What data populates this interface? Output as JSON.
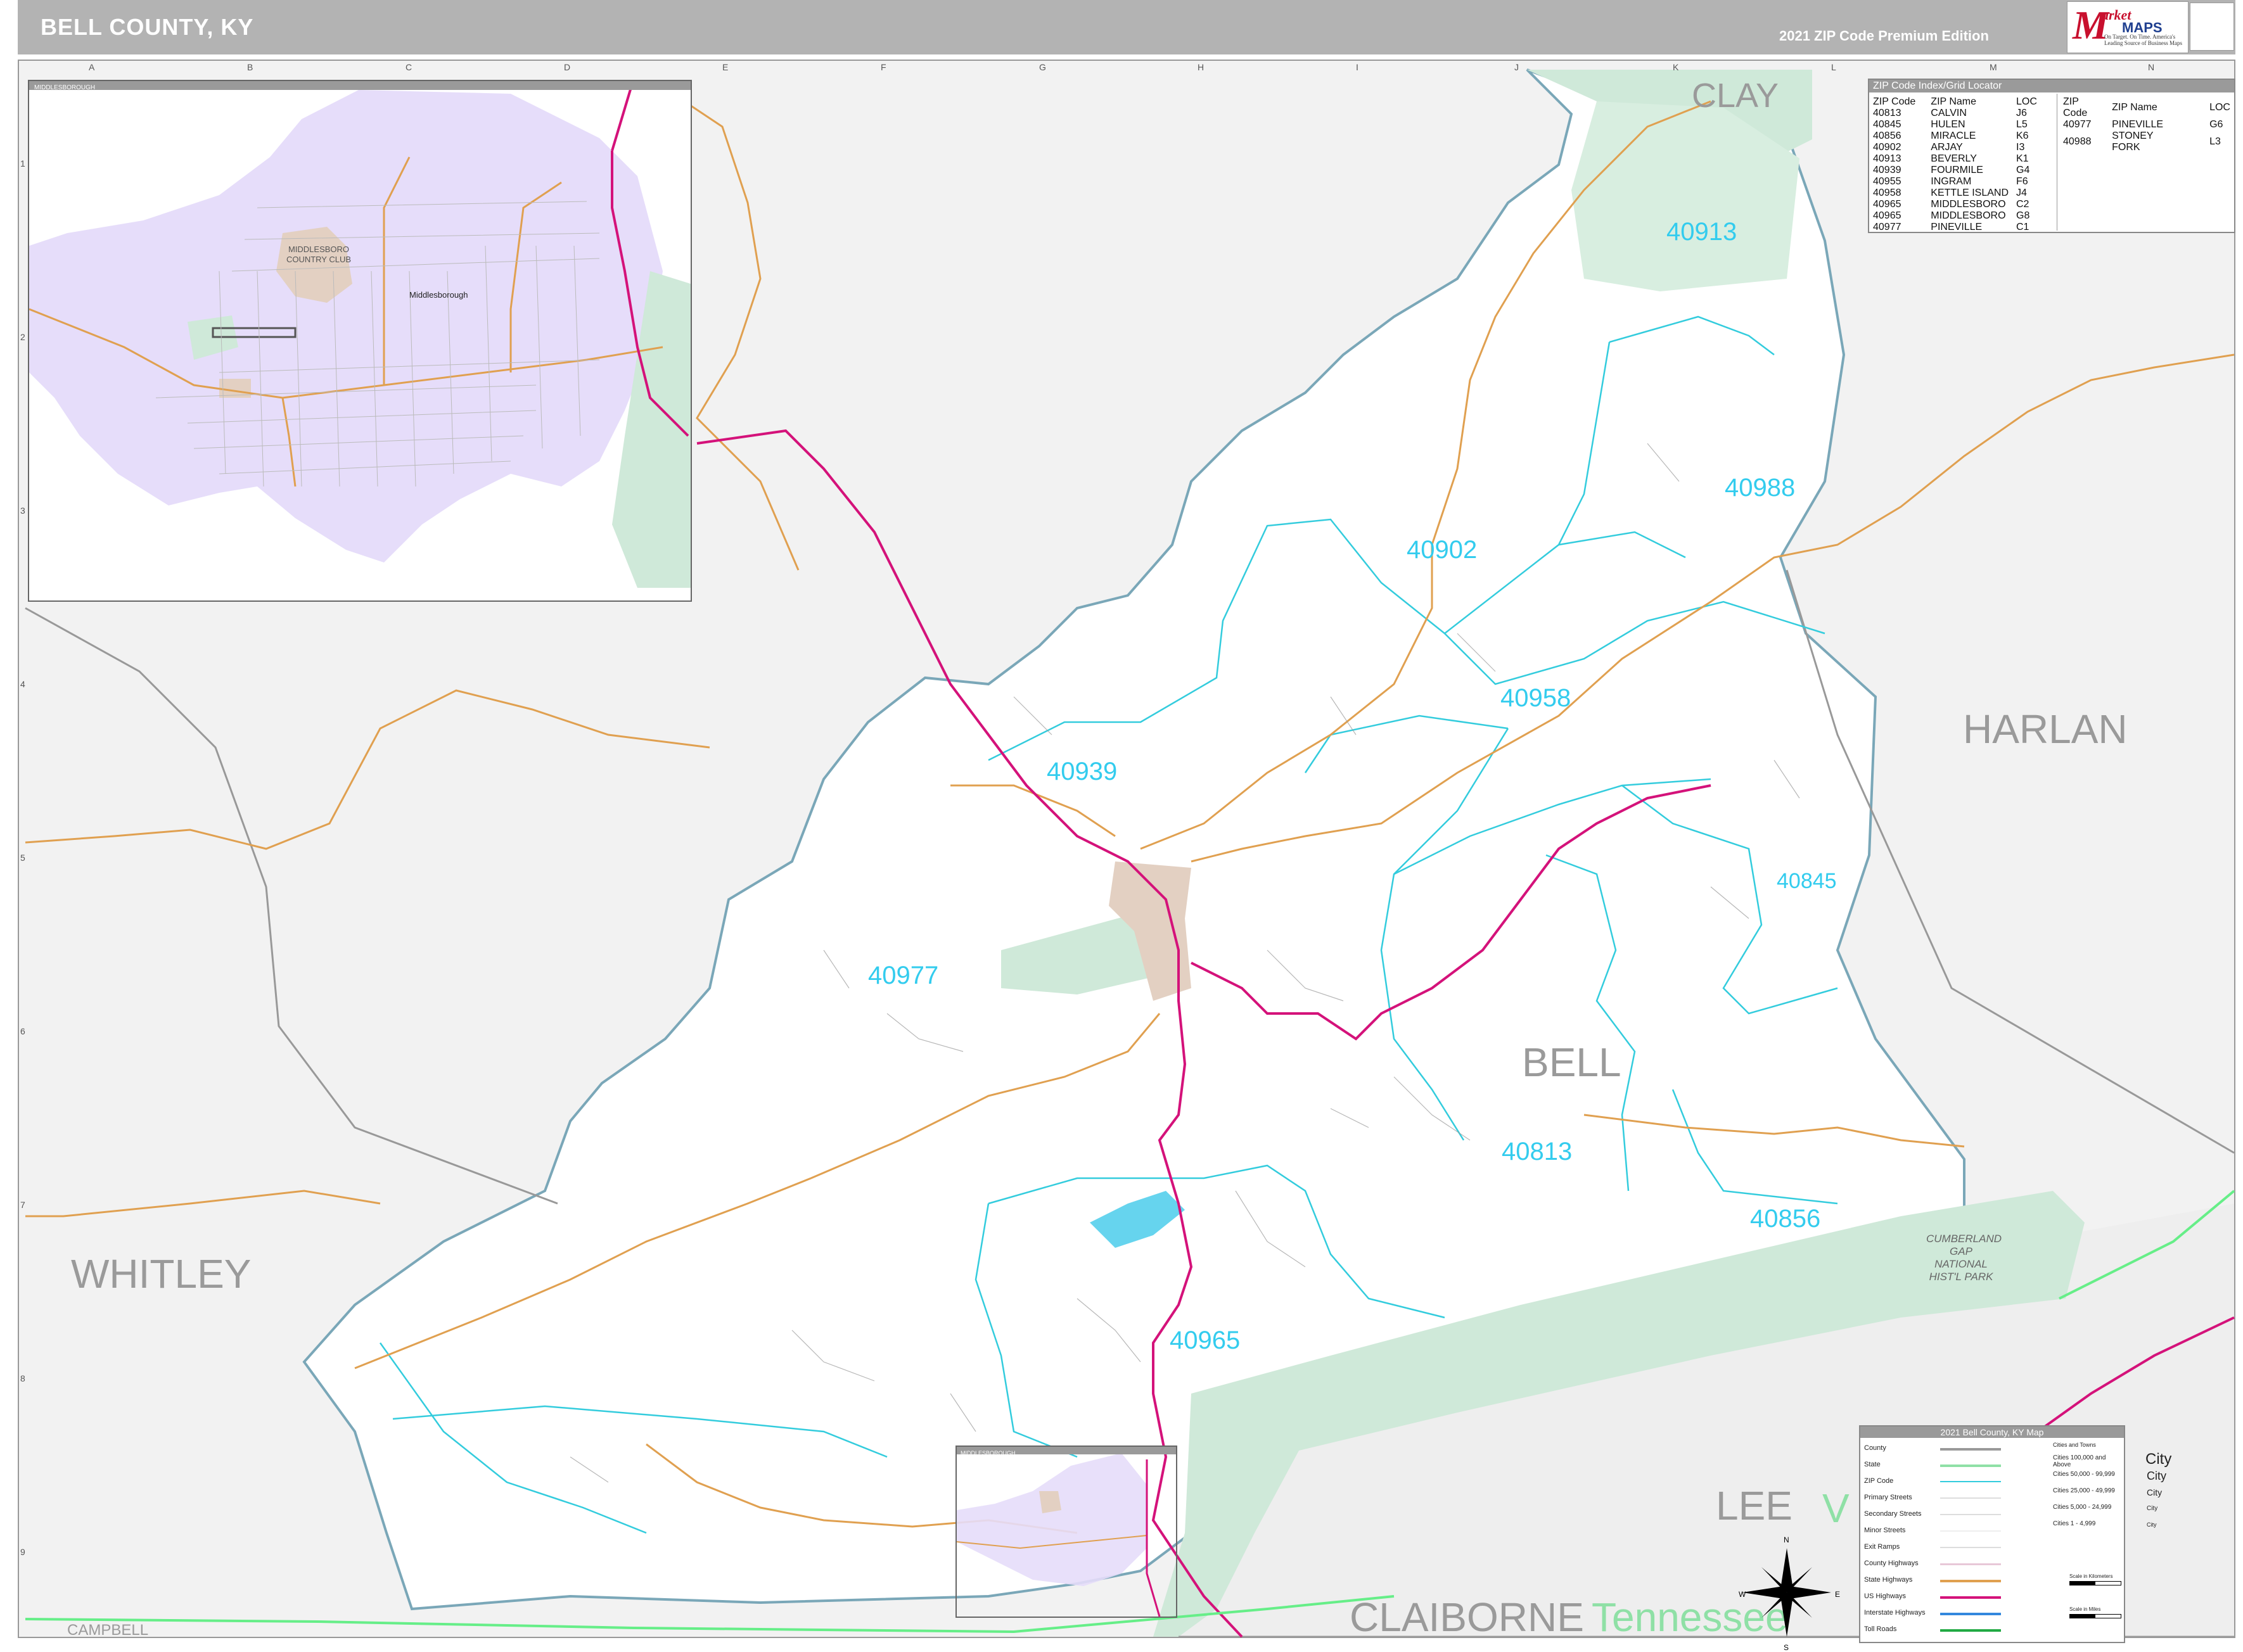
{
  "header": {
    "title": "BELL COUNTY, KY",
    "edition": "2021 ZIP Code Premium Edition",
    "logo_letter": "M",
    "logo_line1": "arket",
    "logo_line2": "MAPS",
    "logo_tagline": "On Target. On Time. America's Leading Source of Business Maps"
  },
  "grid": {
    "columns": [
      "A",
      "B",
      "C",
      "D",
      "E",
      "F",
      "G",
      "H",
      "I",
      "J",
      "K",
      "L",
      "M",
      "N"
    ],
    "rows": [
      "1",
      "2",
      "3",
      "4",
      "5",
      "6",
      "7",
      "8",
      "9"
    ]
  },
  "county_labels": {
    "clay": "CLAY",
    "harlan": "HARLAN",
    "whitley": "WHITLEY",
    "bell": "BELL",
    "lee": "LEE",
    "claiborne": "CLAIBORNE",
    "campbell": "CAMPBELL",
    "tennessee": "Tennessee",
    "virginia_initial": "V"
  },
  "zip_labels": [
    "40913",
    "40988",
    "40902",
    "40958",
    "40939",
    "40845",
    "40977",
    "40813",
    "40856",
    "40965"
  ],
  "park_label": "CUMBERLAND GAP NATIONAL HIST'L PARK",
  "inset": {
    "header": "MIDDLESBOROUGH",
    "country_club": "MIDDLESBORO COUNTRY CLUB",
    "town": "Middlesborough"
  },
  "small_inset_header": "MIDDLESBOROUGH",
  "zip_index": {
    "title": "ZIP Code Index/Grid Locator",
    "headers": [
      "ZIP Code",
      "ZIP Name",
      "LOC"
    ],
    "left": [
      [
        "40813",
        "CALVIN",
        "J6"
      ],
      [
        "40845",
        "HULEN",
        "L5"
      ],
      [
        "40856",
        "MIRACLE",
        "K6"
      ],
      [
        "40902",
        "ARJAY",
        "I3"
      ],
      [
        "40913",
        "BEVERLY",
        "K1"
      ],
      [
        "40939",
        "FOURMILE",
        "G4"
      ],
      [
        "40955",
        "INGRAM",
        "F6"
      ],
      [
        "40958",
        "KETTLE ISLAND",
        "J4"
      ],
      [
        "40965",
        "MIDDLESBORO",
        "C2"
      ],
      [
        "40965",
        "MIDDLESBORO",
        "G8"
      ],
      [
        "40977",
        "PINEVILLE",
        "C1"
      ]
    ],
    "right": [
      [
        "40977",
        "PINEVILLE",
        "G6"
      ],
      [
        "40988",
        "STONEY FORK",
        "L3"
      ]
    ]
  },
  "legend": {
    "title": "2021 Bell County, KY Map",
    "items": [
      "County",
      "State",
      "ZIP Code",
      "Primary Streets",
      "Secondary Streets",
      "Minor Streets",
      "Exit Ramps",
      "County Highways",
      "State Highways",
      "US Highways",
      "Interstate Highways",
      "Toll Roads"
    ],
    "cities_header": "Cities and Towns",
    "cities": [
      {
        "range": "Cities 100,000 and Above",
        "label": "City"
      },
      {
        "range": "Cities 50,000 - 99,999",
        "label": "City"
      },
      {
        "range": "Cities 25,000 - 49,999",
        "label": "City"
      },
      {
        "range": "Cities 5,000 - 24,999",
        "label": "City"
      },
      {
        "range": "Cities 1 - 4,999",
        "label": "City"
      }
    ],
    "scale_km": "Scale in Kilometers",
    "scale_mi": "Scale in Miles"
  },
  "compass": {
    "n": "N",
    "s": "S",
    "e": "E",
    "w": "W"
  },
  "colors": {
    "zip_label": "#33ccee",
    "zip_boundary": "#33ccdd",
    "county_boundary": "#7aa7b8",
    "us_highway": "#d4127a",
    "state_highway": "#e0a050",
    "forest": "#cfe9d9",
    "city_area": "#e3d0c2",
    "urban_purple": "#e6ddfa",
    "outside": "#f2f2f2"
  }
}
